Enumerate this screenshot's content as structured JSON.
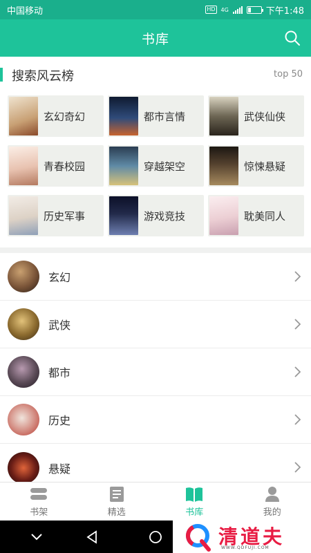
{
  "status_bar": {
    "carrier": "中国移动",
    "hd_badge": "HD",
    "network": "4G",
    "time": "下午1:48"
  },
  "header": {
    "title": "书库"
  },
  "ranking": {
    "title": "搜索风云榜",
    "badge": "top 50",
    "items": [
      {
        "label": "玄幻奇幻",
        "cover_color": "#c8a074"
      },
      {
        "label": "都市言情",
        "cover_color": "#1d2a48"
      },
      {
        "label": "武侠仙侠",
        "cover_color": "#6d6654"
      },
      {
        "label": "青春校园",
        "cover_color": "#e8d2c6"
      },
      {
        "label": "穿越架空",
        "cover_color": "#3c6178"
      },
      {
        "label": "惊悚悬疑",
        "cover_color": "#54412e"
      },
      {
        "label": "历史军事",
        "cover_color": "#ddd2c6"
      },
      {
        "label": "游戏竞技",
        "cover_color": "#222a4a"
      },
      {
        "label": "耽美同人",
        "cover_color": "#eccfd4"
      }
    ]
  },
  "categories": [
    {
      "label": "玄幻",
      "avatar_color": "#7a5438"
    },
    {
      "label": "武侠",
      "avatar_color": "#8b6a2e"
    },
    {
      "label": "都市",
      "avatar_color": "#5a4a56"
    },
    {
      "label": "历史",
      "avatar_color": "#b83a30"
    },
    {
      "label": "悬疑",
      "avatar_color": "#6a1d16"
    }
  ],
  "tabs": [
    {
      "label": "书架",
      "icon": "bookshelf-icon",
      "active": false
    },
    {
      "label": "精选",
      "icon": "featured-icon",
      "active": false
    },
    {
      "label": "书库",
      "icon": "library-book-icon",
      "active": true
    },
    {
      "label": "我的",
      "icon": "profile-icon",
      "active": false
    }
  ],
  "watermark": {
    "text": "清道夫",
    "url": "WWW.QDFUJI.COM"
  },
  "colors": {
    "accent": "#1ec39a",
    "status_bar": "#1aaf8c",
    "watermark_red": "#e81c43"
  }
}
